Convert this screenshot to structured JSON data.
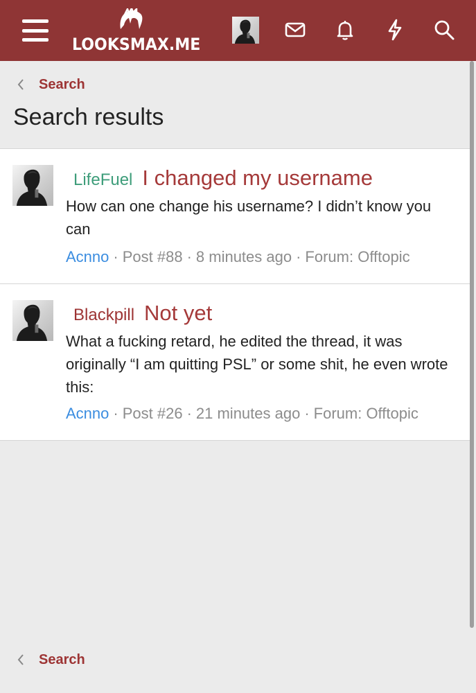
{
  "header": {
    "logo_text": "LOOKSMAX.ME",
    "icons": [
      "menu-icon",
      "avatar",
      "mail-icon",
      "bell-icon",
      "bolt-icon",
      "search-icon"
    ],
    "background_color": "#8f3535"
  },
  "breadcrumb": {
    "label": "Search"
  },
  "page": {
    "title": "Search results"
  },
  "results": [
    {
      "prefix": "LifeFuel",
      "prefix_color": "#3e9d7a",
      "title": "I changed my username",
      "snippet": "How can one change his username? I didn’t know you can",
      "author": "Acnno",
      "post": "Post #88",
      "time": "8 minutes ago",
      "forum": "Forum: Offtopic"
    },
    {
      "prefix": "Blackpill",
      "prefix_color": "#9d3434",
      "title": "Not yet",
      "snippet": "What a fucking retard, he edited the thread, it was originally “I am quitting PSL” or some shit, he even wrote this:",
      "author": "Acnno",
      "post": "Post #26",
      "time": "21 minutes ago",
      "forum": "Forum: Offtopic"
    }
  ],
  "footer_breadcrumb": {
    "label": "Search"
  },
  "colors": {
    "accent": "#9d3434",
    "link": "#3b8de0",
    "meta": "#8c8c8c"
  }
}
